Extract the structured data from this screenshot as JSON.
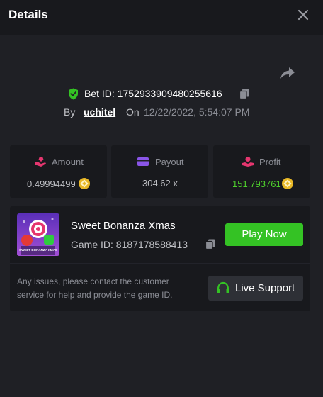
{
  "header": {
    "title": "Details"
  },
  "bet": {
    "id_label": "Bet ID: 1752933909480255616",
    "by_label": "By",
    "user": "uchitel",
    "on_label": "On",
    "date": "12/22/2022, 5:54:07 PM"
  },
  "stats": {
    "amount": {
      "label": "Amount",
      "value": "0.49994499",
      "icon": "bet-hand-icon"
    },
    "payout": {
      "label": "Payout",
      "value": "304.62 x",
      "icon": "card-icon"
    },
    "profit": {
      "label": "Profit",
      "value": "151.793761",
      "icon": "profit-hand-icon"
    }
  },
  "game": {
    "name": "Sweet Bonanza Xmas",
    "id_label": "Game ID: 8187178588413",
    "play_label": "Play Now",
    "thumb_text": "SWEET BONANZA XMAS"
  },
  "support": {
    "text": "Any issues, please contact the customer service for help and provide the game ID.",
    "button_label": "Live Support"
  },
  "colors": {
    "background": "#1f2025",
    "panel": "#18191d",
    "accent_green": "#34c224",
    "profit_green": "#4ecf2c",
    "coin": "#e9b826",
    "muted_text": "#8b8d95"
  }
}
